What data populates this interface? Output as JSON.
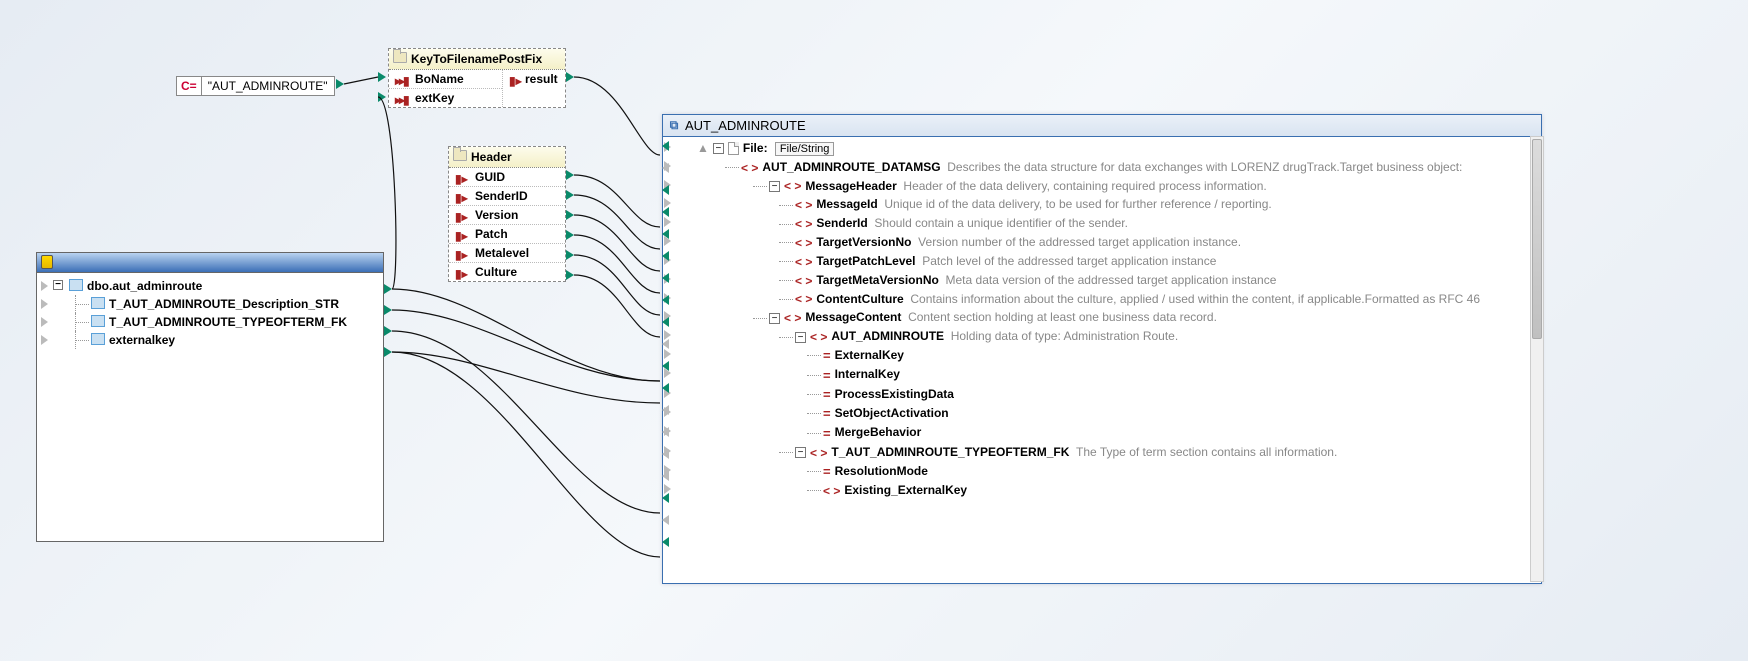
{
  "constant": {
    "prefix": "C=",
    "value": "\"AUT_ADMINROUTE\""
  },
  "func1": {
    "title": "KeyToFilenamePostFix",
    "inputs": [
      "BoName",
      "extKey"
    ],
    "outputs": [
      "result"
    ]
  },
  "func2": {
    "title": "Header",
    "outputs": [
      "GUID",
      "SenderID",
      "Version",
      "Patch",
      "Metalevel",
      "Culture"
    ]
  },
  "db": {
    "root": "dbo.aut_adminroute",
    "children": [
      "T_AUT_ADMINROUTE_Description_STR",
      "T_AUT_ADMINROUTE_TYPEOFTERM_FK",
      "externalkey"
    ]
  },
  "target": {
    "title": "AUT_ADMINROUTE",
    "file_label": "File: <dynamic>",
    "file_button": "File/String",
    "tree": [
      {
        "kind": "file",
        "indent": 1,
        "name": ""
      },
      {
        "kind": "tag",
        "indent": 2,
        "name": "AUT_ADMINROUTE_DATAMSG",
        "desc": "Describes the data structure for data exchanges with LORENZ drugTrack.Target business object:"
      },
      {
        "kind": "tag",
        "indent": 3,
        "toggle": "-",
        "name": "MessageHeader",
        "desc": "Header of the data delivery, containing required process information."
      },
      {
        "kind": "tag",
        "indent": 4,
        "name": "MessageId",
        "desc": "Unique id of the data delivery, to be used for further reference / reporting."
      },
      {
        "kind": "tag",
        "indent": 4,
        "name": "SenderId",
        "desc": "Should contain a unique identifier of the sender."
      },
      {
        "kind": "tag",
        "indent": 4,
        "name": "TargetVersionNo",
        "desc": "Version number of the addressed target application instance."
      },
      {
        "kind": "tag",
        "indent": 4,
        "name": "TargetPatchLevel",
        "desc": "Patch level of the addressed target application instance"
      },
      {
        "kind": "tag",
        "indent": 4,
        "name": "TargetMetaVersionNo",
        "desc": "Meta data version of the addressed target application instance"
      },
      {
        "kind": "tag",
        "indent": 4,
        "name": "ContentCulture",
        "desc": "Contains information about the culture, applied / used within the content, if applicable.Formatted as RFC 46"
      },
      {
        "kind": "tag",
        "indent": 3,
        "toggle": "-",
        "name": "MessageContent",
        "desc": "Content section holding at least one business data record."
      },
      {
        "kind": "tag",
        "indent": 4,
        "toggle": "-",
        "name": "AUT_ADMINROUTE",
        "desc": "Holding data of type: Administration Route."
      },
      {
        "kind": "eq",
        "indent": 5,
        "name": "ExternalKey"
      },
      {
        "kind": "eq",
        "indent": 5,
        "name": "InternalKey"
      },
      {
        "kind": "eq",
        "indent": 5,
        "name": "ProcessExistingData"
      },
      {
        "kind": "eq",
        "indent": 5,
        "name": "SetObjectActivation"
      },
      {
        "kind": "eq",
        "indent": 5,
        "name": "MergeBehavior"
      },
      {
        "kind": "tag",
        "indent": 4,
        "toggle": "-",
        "name": "T_AUT_ADMINROUTE_TYPEOFTERM_FK",
        "desc": "The Type of term section contains all information."
      },
      {
        "kind": "eq",
        "indent": 5,
        "name": "ResolutionMode"
      },
      {
        "kind": "tag",
        "indent": 5,
        "name": "Existing_ExternalKey"
      }
    ]
  },
  "connections": [
    {
      "from": "const.out",
      "to": "func1.BoName"
    },
    {
      "from": "func1.result",
      "to": "target.file"
    },
    {
      "from": "db.root",
      "to": "func1.extKey"
    },
    {
      "from": "db.root",
      "to": "target.AUT_ADMINROUTE"
    },
    {
      "from": "db.child.0",
      "to": "target.AUT_ADMINROUTE"
    },
    {
      "from": "db.child.1",
      "to": "target.T_AUT_ADMINROUTE_TYPEOFTERM_FK"
    },
    {
      "from": "db.child.2",
      "to": "target.ExternalKey"
    },
    {
      "from": "db.child.2",
      "to": "target.Existing_ExternalKey"
    },
    {
      "from": "func2.GUID",
      "to": "target.MessageId"
    },
    {
      "from": "func2.SenderID",
      "to": "target.SenderId"
    },
    {
      "from": "func2.Version",
      "to": "target.TargetVersionNo"
    },
    {
      "from": "func2.Patch",
      "to": "target.TargetPatchLevel"
    },
    {
      "from": "func2.Metalevel",
      "to": "target.TargetMetaVersionNo"
    },
    {
      "from": "func2.Culture",
      "to": "target.ContentCulture"
    }
  ]
}
